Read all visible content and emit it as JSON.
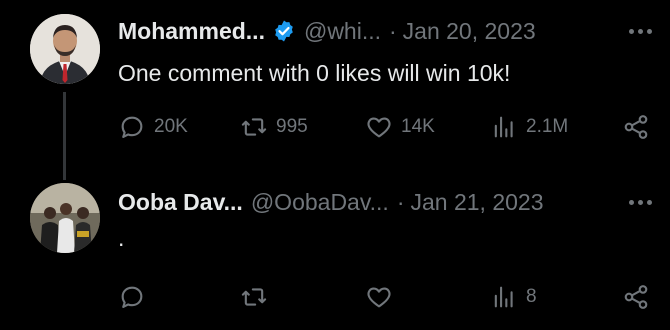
{
  "tweets": [
    {
      "display_name": "Mohammed...",
      "verified": true,
      "handle": "@whi...",
      "separator": "·",
      "date": "Jan 20, 2023",
      "text": "One comment with 0 likes will win 10k!",
      "reply_count": "20K",
      "retweet_count": "995",
      "like_count": "14K",
      "view_count": "2.1M"
    },
    {
      "display_name": "Ooba Dav...",
      "verified": false,
      "handle": "@OobaDav...",
      "separator": "·",
      "date": "Jan 21, 2023",
      "text": ".",
      "reply_count": "",
      "retweet_count": "",
      "like_count": "",
      "view_count": "8"
    }
  ],
  "colors": {
    "background": "#000000",
    "primary_text": "#e7e9ea",
    "secondary_text": "#71767b",
    "verified_badge": "#1d9bf0",
    "thread_line": "#333639"
  },
  "icons": {
    "verified": "verified-badge-icon",
    "more": "more-horizontal-icon",
    "reply": "reply-icon",
    "retweet": "retweet-icon",
    "like": "heart-icon",
    "views": "views-chart-icon",
    "share": "share-icon"
  }
}
